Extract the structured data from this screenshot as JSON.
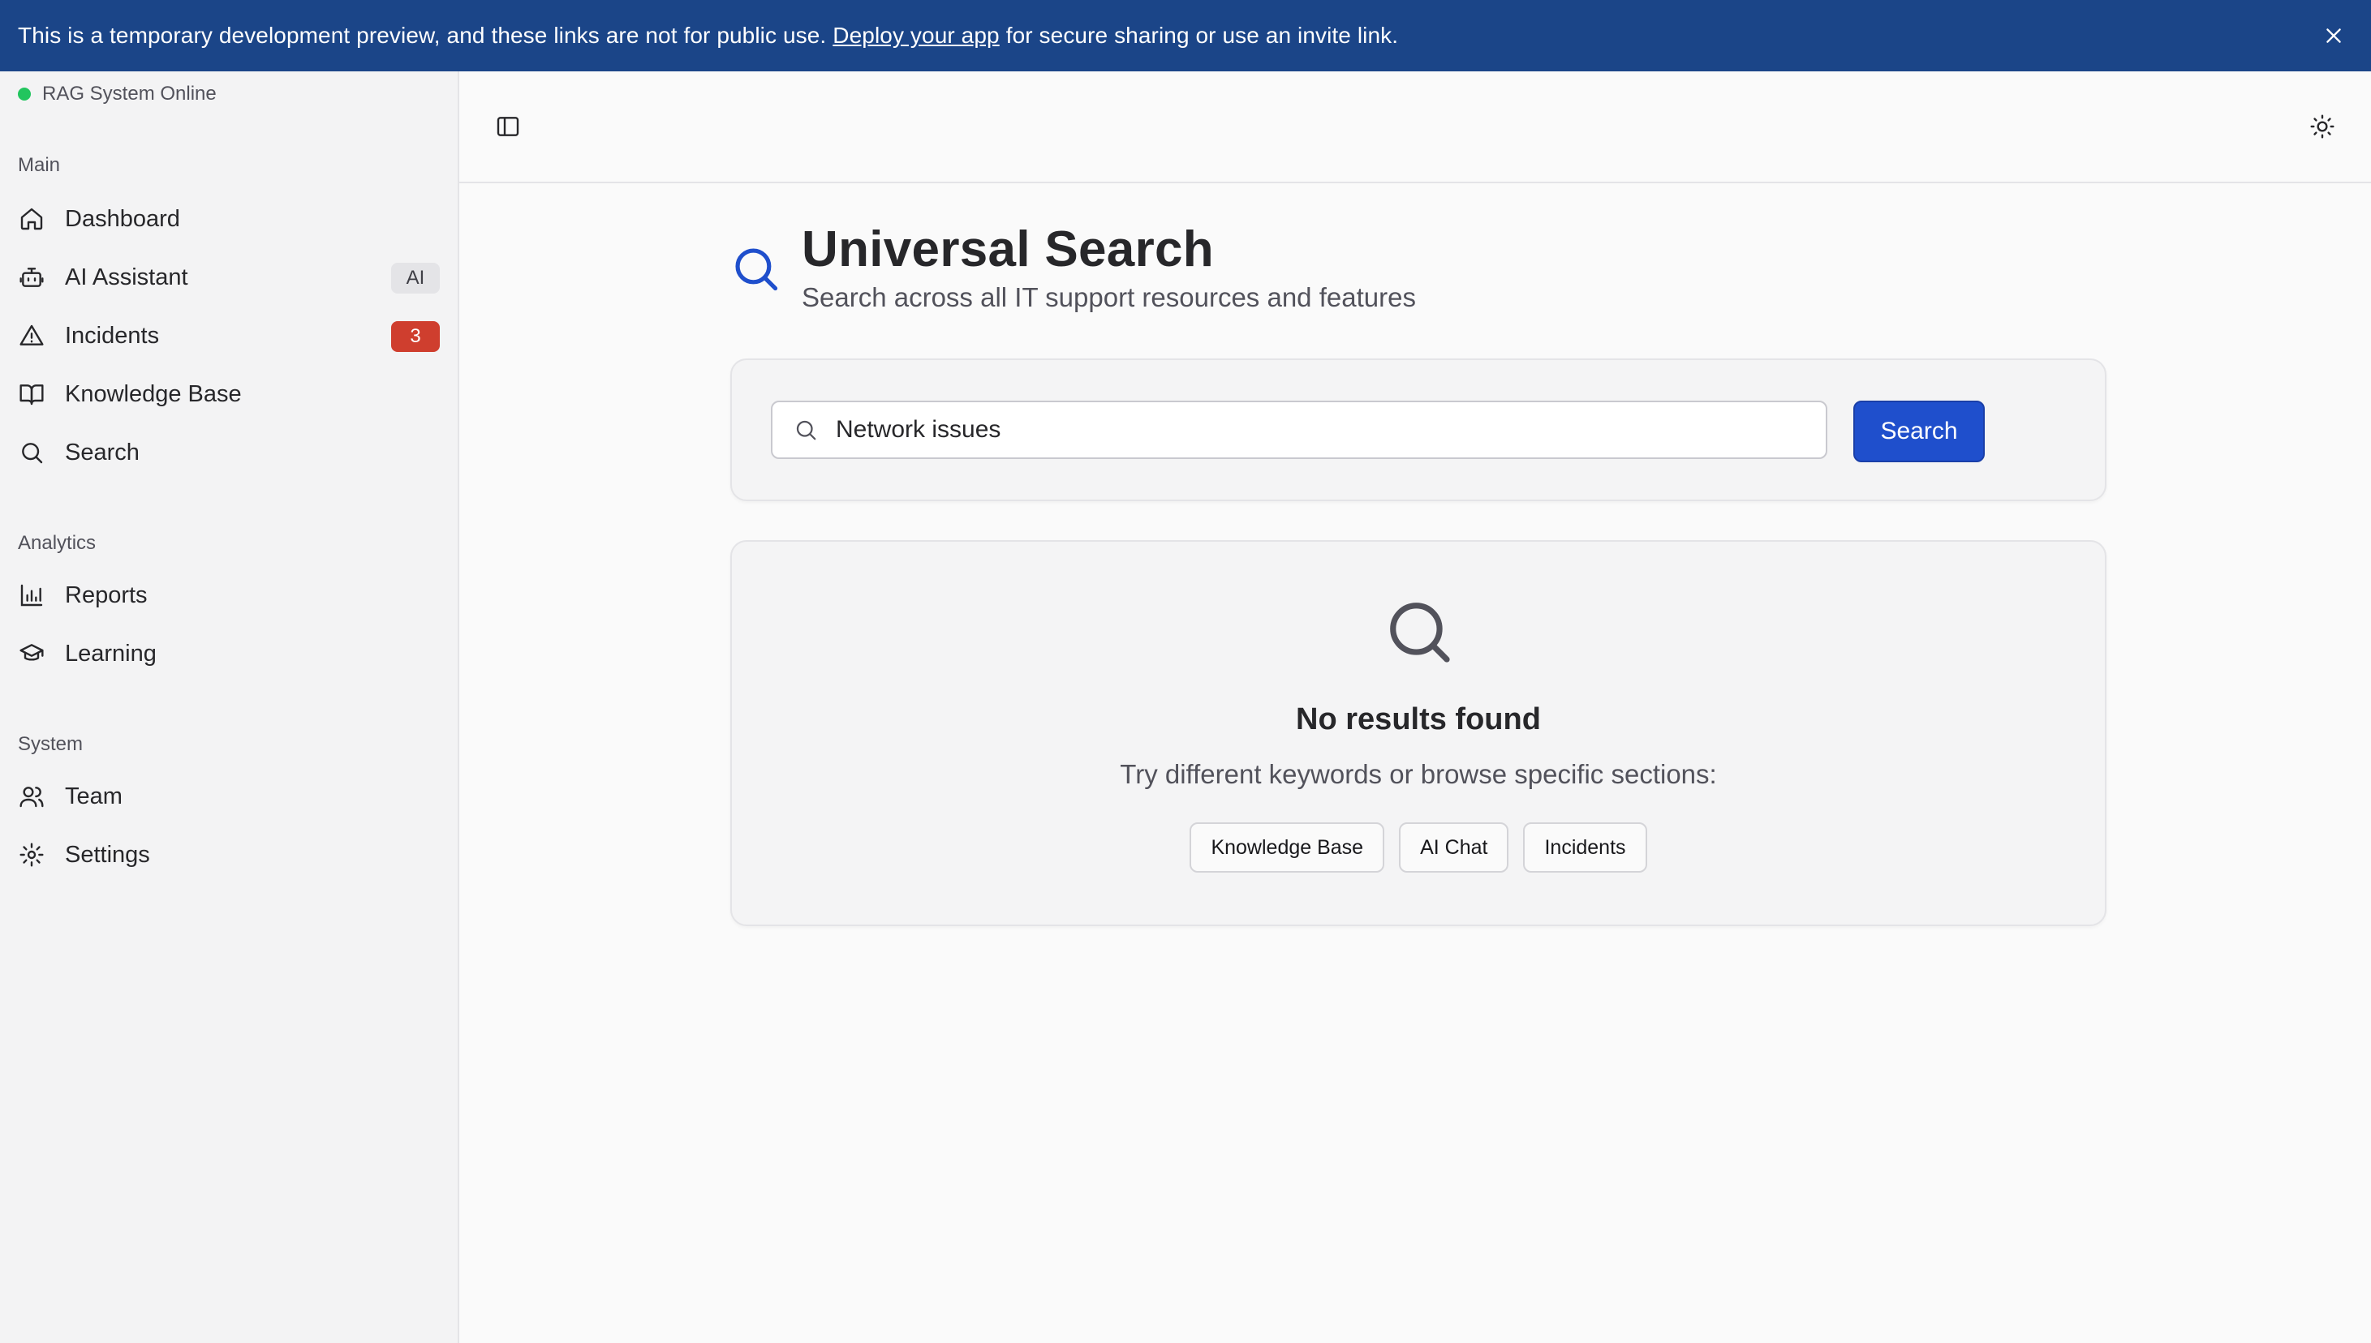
{
  "banner": {
    "text_before": "This is a temporary development preview, and these links are not for public use.",
    "link": "Deploy your app",
    "text_after": "for secure sharing or use an invite link.",
    "bg_color": "#1b4588"
  },
  "sidebar": {
    "status": "RAG System Online",
    "status_color": "#22c55e",
    "groups": {
      "main": {
        "label": "Main",
        "items": [
          {
            "label": "Dashboard",
            "icon": "home-icon"
          },
          {
            "label": "AI Assistant",
            "icon": "bot-icon",
            "badge": "AI"
          },
          {
            "label": "Incidents",
            "icon": "alert-triangle-icon",
            "badge": "3"
          },
          {
            "label": "Knowledge Base",
            "icon": "book-open-icon"
          },
          {
            "label": "Search",
            "icon": "search-icon"
          }
        ]
      },
      "analytics": {
        "label": "Analytics",
        "items": [
          {
            "label": "Reports",
            "icon": "bar-chart-icon"
          },
          {
            "label": "Learning",
            "icon": "graduation-cap-icon"
          }
        ]
      },
      "system": {
        "label": "System",
        "items": [
          {
            "label": "Team",
            "icon": "users-icon"
          },
          {
            "label": "Settings",
            "icon": "gear-icon"
          }
        ]
      }
    }
  },
  "topbar": {
    "toggle_icon": "sidebar-toggle-icon",
    "theme_icon": "sun-icon"
  },
  "page": {
    "title": "Universal Search",
    "subtitle": "Search across all IT support resources and features",
    "accent_color": "#1f4fcc"
  },
  "search": {
    "value": "Network issues",
    "button_label": "Search"
  },
  "results": {
    "empty_title": "No results found",
    "empty_subtitle": "Try different keywords or browse specific sections:",
    "chips": [
      "Knowledge Base",
      "AI Chat",
      "Incidents"
    ]
  }
}
